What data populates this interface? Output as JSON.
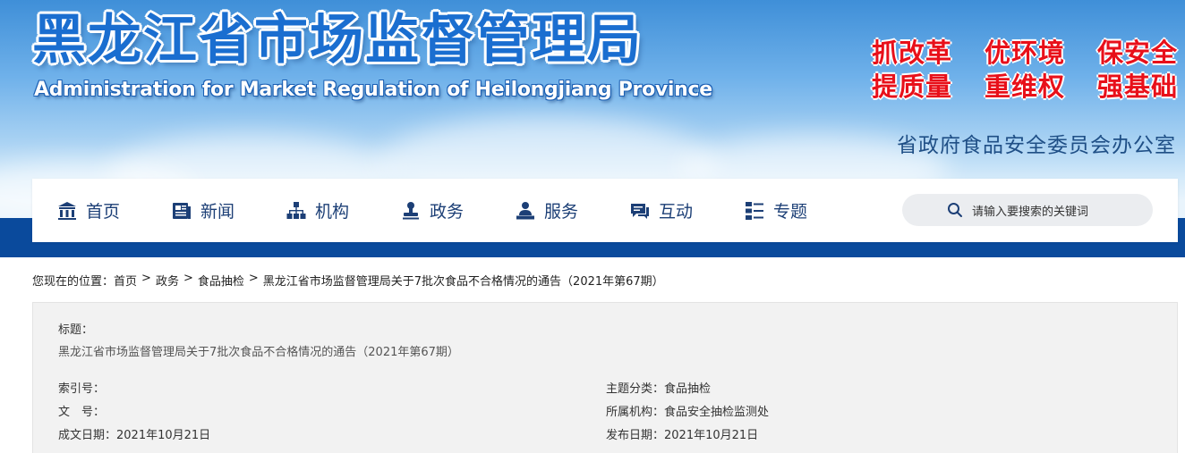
{
  "header": {
    "title_cn": "黑龙江省市场监督管理局",
    "title_en": "Administration for Market Regulation of Heilongjiang Province",
    "slogans_row1": [
      "抓改革",
      "优环境",
      "保安全"
    ],
    "slogans_row2": [
      "提质量",
      "重维权",
      "强基础"
    ],
    "office": "省政府食品安全委员会办公室"
  },
  "nav": {
    "items": [
      {
        "label": "首页",
        "icon": "bank-icon"
      },
      {
        "label": "新闻",
        "icon": "newspaper-icon"
      },
      {
        "label": "机构",
        "icon": "org-chart-icon"
      },
      {
        "label": "政务",
        "icon": "stamp-icon"
      },
      {
        "label": "服务",
        "icon": "service-person-icon"
      },
      {
        "label": "互动",
        "icon": "chat-icon"
      },
      {
        "label": "专题",
        "icon": "list-icon"
      }
    ],
    "search_placeholder": "请输入要搜索的关键词"
  },
  "breadcrumb": {
    "prefix": "您现在的位置：",
    "items": [
      "首页",
      "政务",
      "食品抽检",
      "黑龙江省市场监督管理局关于7批次食品不合格情况的通告（2021年第67期）"
    ],
    "separator": ">"
  },
  "info": {
    "title_label": "标题：",
    "title_value": "黑龙江省市场监督管理局关于7批次食品不合格情况的通告（2021年第67期）",
    "index_label": "索引号：",
    "index_value": "",
    "doc_label": "文　号：",
    "doc_value": "",
    "created_label": "成文日期：",
    "created_value": "2021年10月21日",
    "theme_label": "主题分类：",
    "theme_value": "食品抽检",
    "org_label": "所属机构：",
    "org_value": "食品安全抽检监测处",
    "published_label": "发布日期：",
    "published_value": "2021年10月21日"
  },
  "colors": {
    "brand_blue": "#1a6ed0",
    "nav_text": "#1c3f76",
    "slogan_red": "#e8101a",
    "band_blue": "#0a4a9c"
  }
}
